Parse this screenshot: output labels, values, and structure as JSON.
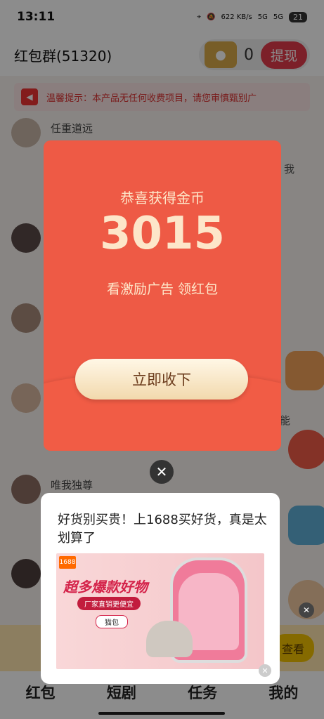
{
  "status_bar": {
    "time": "13:11",
    "net_speed": "622 KB/s",
    "sig1": "5G",
    "sig2": "5G",
    "battery": "21"
  },
  "header": {
    "title": "红包群(51320)",
    "coins": "0",
    "withdraw_label": "提现"
  },
  "notice": {
    "text": "温馨提示：本产品无任何收费项目，请您审慎甄别广"
  },
  "chat": {
    "messages": [
      {
        "name": "任重道远"
      },
      {
        "name": "唯我独尊"
      }
    ],
    "side_texts": [
      "我",
      "能"
    ]
  },
  "bottom_strip": {
    "button_label": "查看"
  },
  "tabs": [
    {
      "label": "红包"
    },
    {
      "label": "短剧"
    },
    {
      "label": "任务"
    },
    {
      "label": "我的"
    }
  ],
  "reward_dialog": {
    "title": "恭喜获得金币",
    "amount": "3015",
    "subtitle": "看激励广告 领红包",
    "collect_label": "立即收下"
  },
  "ad": {
    "text": "好货别买贵！上1688买好货，真是太划算了",
    "logo_text": "1688",
    "headline": "超多爆款好物",
    "sub_pill": "厂家直销更便宜",
    "search_word": "猫包"
  },
  "colors": {
    "red_packet": "#ee5a45",
    "gold_text": "#fde6c9",
    "withdraw": "#e23b4c"
  }
}
